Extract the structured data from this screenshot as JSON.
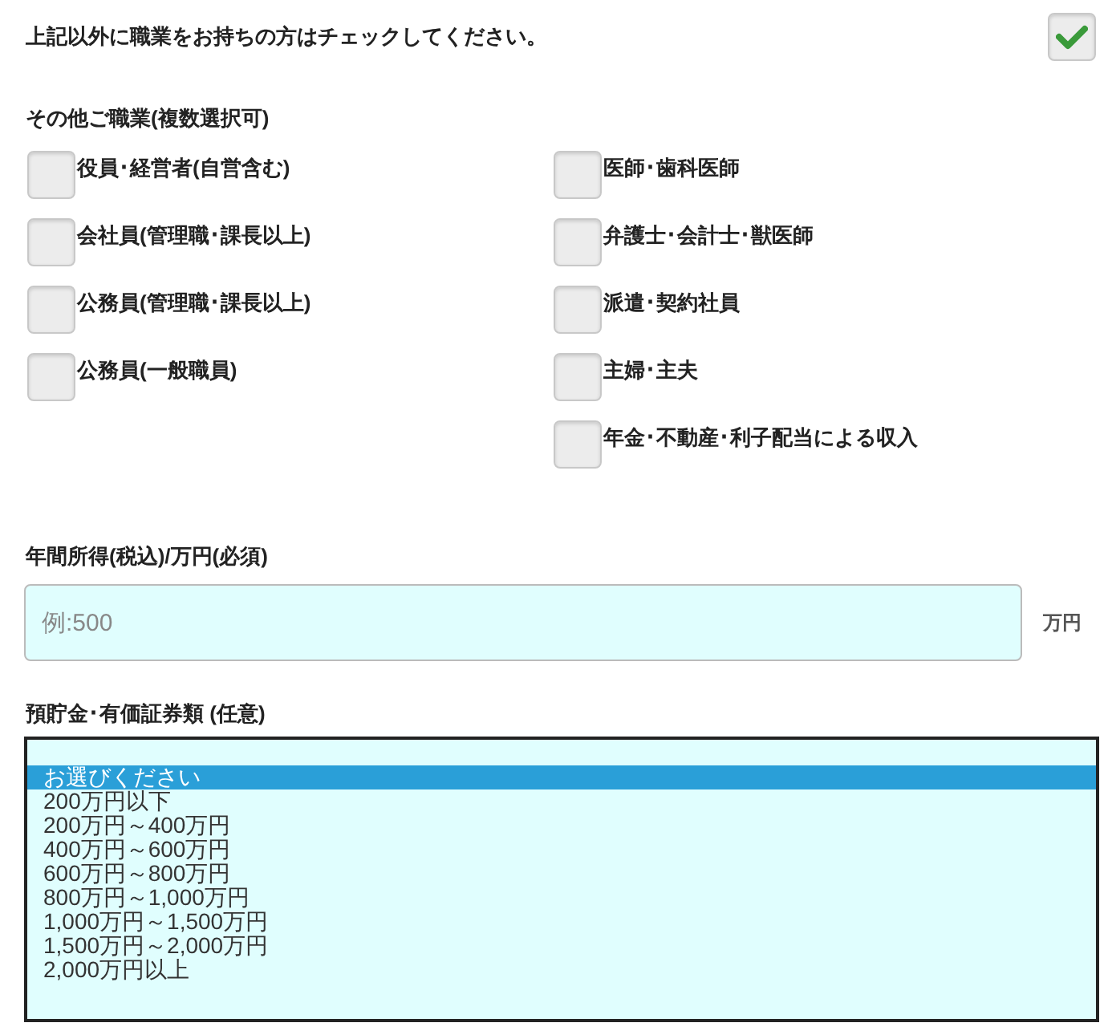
{
  "other_job_prompt": {
    "label": "上記以外に職業をお持ちの方はチェックしてください。",
    "checked": true
  },
  "occupations": {
    "title": "その他ご職業(複数選択可)",
    "columns": [
      [
        {
          "label": "役員･経営者(自営含む)",
          "checked": false
        },
        {
          "label": "会社員(管理職･課長以上)",
          "checked": false
        },
        {
          "label": "公務員(管理職･課長以上)",
          "checked": false
        },
        {
          "label": "公務員(一般職員)",
          "checked": false
        }
      ],
      [
        {
          "label": "医師･歯科医師",
          "checked": false
        },
        {
          "label": "弁護士･会計士･獣医師",
          "checked": false
        },
        {
          "label": "派遣･契約社員",
          "checked": false
        },
        {
          "label": "主婦･主夫",
          "checked": false
        },
        {
          "label": "年金･不動産･利子配当による収入",
          "checked": false
        }
      ]
    ]
  },
  "annual_income": {
    "label": "年間所得(税込)/万円(必須)",
    "placeholder": "例:500",
    "unit": "万円"
  },
  "savings": {
    "label": "預貯金･有価証券類 (任意)",
    "options": [
      {
        "label": "お選びください",
        "selected": true
      },
      {
        "label": "200万円以下",
        "selected": false
      },
      {
        "label": "200万円～400万円",
        "selected": false
      },
      {
        "label": "400万円～600万円",
        "selected": false
      },
      {
        "label": "600万円～800万円",
        "selected": false
      },
      {
        "label": "800万円～1,000万円",
        "selected": false
      },
      {
        "label": "1,000万円～1,500万円",
        "selected": false
      },
      {
        "label": "1,500万円～2,000万円",
        "selected": false
      },
      {
        "label": "2,000万円以上",
        "selected": false
      }
    ]
  }
}
